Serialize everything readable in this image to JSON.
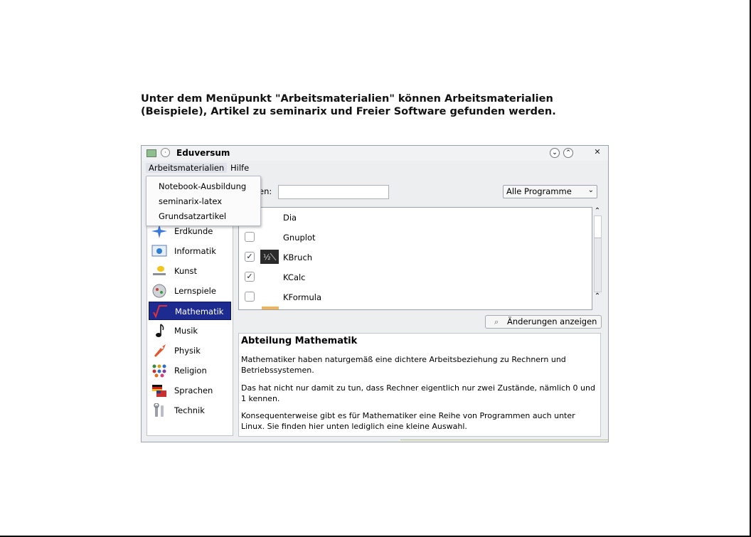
{
  "intro": {
    "line1": "Unter dem Menüpunkt \"Arbeitsmaterialien\" können Arbeitsmaterialien",
    "line2": "(Beispiele), Artikel zu seminarix und Freier Software gefunden werden."
  },
  "window": {
    "title": "Eduversum",
    "buttons": {
      "minimize": "⌄",
      "maximize": "⌃",
      "close": "✕"
    }
  },
  "menubar": {
    "items": [
      {
        "label": "Arbeitsmaterialien"
      },
      {
        "label": "Hilfe"
      }
    ]
  },
  "dropdown": {
    "items": [
      {
        "label": "Notebook-Ausbildung"
      },
      {
        "label": "seminarix-latex"
      },
      {
        "label": "Grundsatzartikel"
      }
    ]
  },
  "sidebar": {
    "items": [
      {
        "label": "Erdkunde",
        "icon": "star-compass-icon",
        "selected": false
      },
      {
        "label": "Informatik",
        "icon": "computer-icon",
        "selected": false
      },
      {
        "label": "Kunst",
        "icon": "brush-icon",
        "selected": false
      },
      {
        "label": "Lernspiele",
        "icon": "game-icon",
        "selected": false
      },
      {
        "label": "Mathematik",
        "icon": "sqrt-icon",
        "selected": true
      },
      {
        "label": "Musik",
        "icon": "music-note-icon",
        "selected": false
      },
      {
        "label": "Physik",
        "icon": "rocket-icon",
        "selected": false
      },
      {
        "label": "Religion",
        "icon": "religion-symbols-icon",
        "selected": false
      },
      {
        "label": "Sprachen",
        "icon": "flags-icon",
        "selected": false
      },
      {
        "label": "Technik",
        "icon": "tools-icon",
        "selected": false
      }
    ]
  },
  "search": {
    "label_partial": "en:",
    "value": "",
    "filter_selected": "Alle Programme"
  },
  "programs": [
    {
      "name": "Dia",
      "checked": null
    },
    {
      "name": "Gnuplot",
      "checked": false
    },
    {
      "name": "KBruch",
      "checked": true
    },
    {
      "name": "KCalc",
      "checked": true
    },
    {
      "name": "KFormula",
      "checked": false
    }
  ],
  "changes_button": {
    "label": "Änderungen anzeigen",
    "icon": "magnifier-icon"
  },
  "description": {
    "heading": "Abteilung Mathematik",
    "p1": "Mathematiker haben naturgemäß eine dichtere Arbeitsbeziehung zu Rechnern und Betriebssystemen.",
    "p2": "Das hat nicht nur damit zu tun, dass Rechner eigentlich nur zwei Zustände, nämlich 0 und 1 kennen.",
    "p3": "Konsequenterweise gibt es für Mathematiker eine Reihe von Programmen auch unter Linux. Sie finden hier unten lediglich eine kleine Auswahl."
  },
  "colors": {
    "selection": "#1d2a8f",
    "window_bg": "#edeeef"
  }
}
